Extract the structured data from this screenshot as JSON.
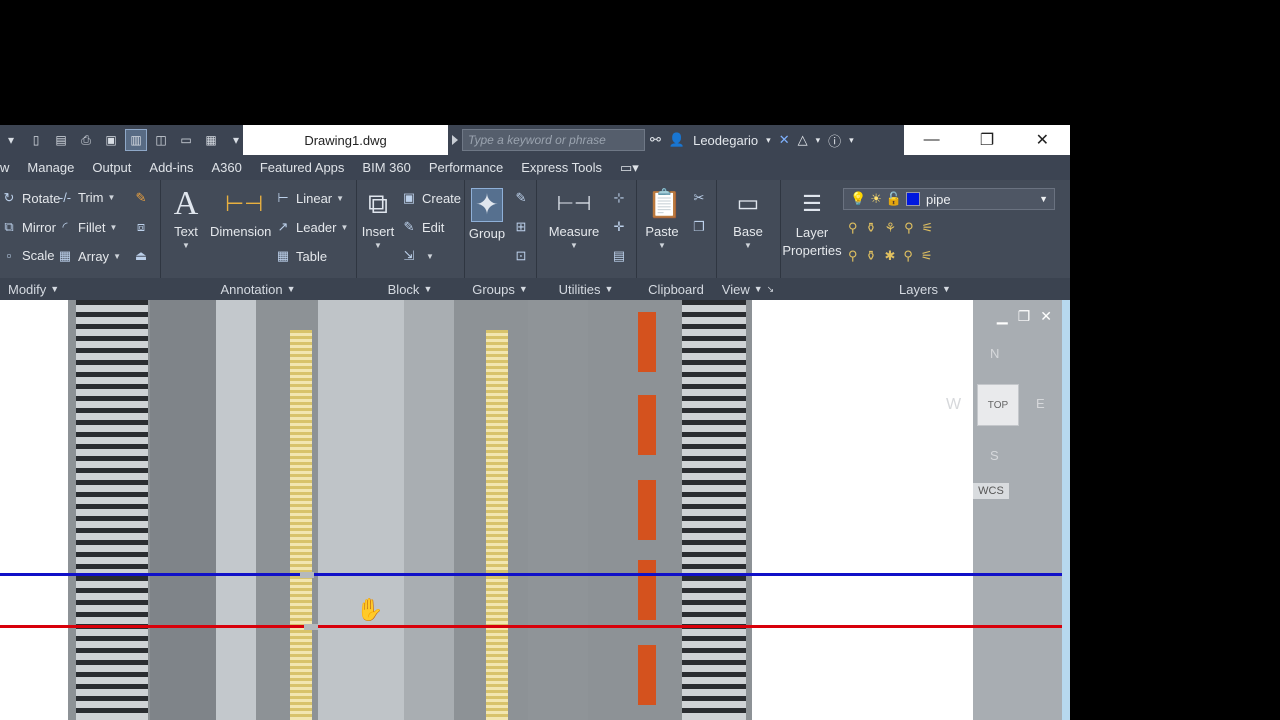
{
  "titlebar": {
    "document_tab": "Drawing1.dwg",
    "search_placeholder": "Type a keyword or phrase",
    "user": "Leodegario"
  },
  "menu_tabs": [
    "w",
    "Manage",
    "Output",
    "Add-ins",
    "A360",
    "Featured Apps",
    "BIM 360",
    "Performance",
    "Express Tools"
  ],
  "ribbon": {
    "modify": {
      "label": "Modify",
      "tools": [
        "Rotate",
        "Trim",
        "Mirror",
        "Fillet",
        "Scale",
        "Array"
      ]
    },
    "annotation": {
      "label": "Annotation",
      "text": "Text",
      "dimension": "Dimension",
      "linear": "Linear",
      "leader": "Leader",
      "table": "Table"
    },
    "block": {
      "label": "Block",
      "insert": "Insert",
      "create": "Create",
      "edit": "Edit"
    },
    "groups": {
      "label": "Groups",
      "group": "Group"
    },
    "utilities": {
      "label": "Utilities",
      "measure": "Measure"
    },
    "clipboard": {
      "label": "Clipboard",
      "paste": "Paste"
    },
    "view": {
      "label": "View",
      "base": "Base"
    },
    "layers": {
      "label": "Layers",
      "layer_properties_line1": "Layer",
      "layer_properties_line2": "Properties",
      "current_layer": "pipe",
      "current_layer_color": "#0018e0"
    }
  },
  "viewport": {
    "viewcube_face": "TOP",
    "compass_n": "N",
    "compass_s": "S",
    "compass_w": "W",
    "compass_e": "E",
    "wcs": "WCS",
    "line_colors": {
      "blue": "#1010c8",
      "red": "#d8000a"
    }
  }
}
